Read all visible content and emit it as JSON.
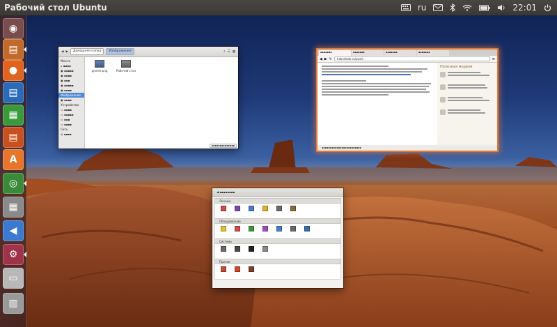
{
  "top_panel": {
    "title": "Рабочий стол Ubuntu",
    "keyboard_layout": "ru",
    "time": "22:01"
  },
  "launcher": {
    "items": [
      {
        "name": "dash-home",
        "glyph": "◉",
        "color": "#7a4d4d"
      },
      {
        "name": "files",
        "glyph": "▤",
        "color": "#c26a2a"
      },
      {
        "name": "firefox",
        "glyph": "●",
        "color": "#e0641e"
      },
      {
        "name": "libreoffice-writer",
        "glyph": "▤",
        "color": "#2a6ab8"
      },
      {
        "name": "libreoffice-calc",
        "glyph": "▦",
        "color": "#3a9a3a"
      },
      {
        "name": "libreoffice-impress",
        "glyph": "▤",
        "color": "#c8501e"
      },
      {
        "name": "software-center",
        "glyph": "A",
        "color": "#e8752a"
      },
      {
        "name": "chromium",
        "glyph": "◎",
        "color": "#3a8a3a"
      },
      {
        "name": "calculator",
        "glyph": "▦",
        "color": "#8a8a8a"
      },
      {
        "name": "sound",
        "glyph": "◀",
        "color": "#3a7ad0"
      },
      {
        "name": "system-settings",
        "glyph": "⚙",
        "color": "#a0324a"
      },
      {
        "name": "drive",
        "glyph": "▭",
        "color": "#b8b8b8"
      },
      {
        "name": "trash",
        "glyph": "▥",
        "color": "#9a9a9a"
      }
    ]
  },
  "file_manager": {
    "crumbs": [
      "Домашняя папка",
      "Изображения"
    ],
    "sidebar_header_devices": "Устройства",
    "sidebar_header_places": "Места",
    "sidebar_header_network": "Сеть",
    "selected_sidebar_item": "Изображения",
    "files": [
      "gnome.png",
      "Рабочий стол"
    ]
  },
  "browser": {
    "url": "habrahabr.ru/post/...",
    "aside_title": "Полезная модели"
  },
  "system_settings": {
    "sections": [
      "Личные",
      "Оборудование",
      "Система",
      "Прочие"
    ]
  }
}
